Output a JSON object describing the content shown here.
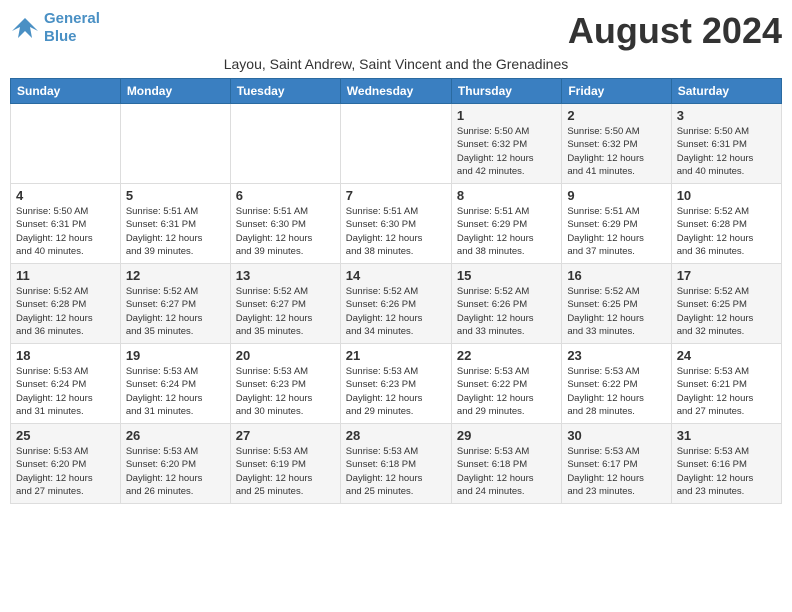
{
  "logo": {
    "line1": "General",
    "line2": "Blue"
  },
  "title": "August 2024",
  "location": "Layou, Saint Andrew, Saint Vincent and the Grenadines",
  "days_of_week": [
    "Sunday",
    "Monday",
    "Tuesday",
    "Wednesday",
    "Thursday",
    "Friday",
    "Saturday"
  ],
  "weeks": [
    [
      {
        "day": "",
        "info": ""
      },
      {
        "day": "",
        "info": ""
      },
      {
        "day": "",
        "info": ""
      },
      {
        "day": "",
        "info": ""
      },
      {
        "day": "1",
        "info": "Sunrise: 5:50 AM\nSunset: 6:32 PM\nDaylight: 12 hours\nand 42 minutes."
      },
      {
        "day": "2",
        "info": "Sunrise: 5:50 AM\nSunset: 6:32 PM\nDaylight: 12 hours\nand 41 minutes."
      },
      {
        "day": "3",
        "info": "Sunrise: 5:50 AM\nSunset: 6:31 PM\nDaylight: 12 hours\nand 40 minutes."
      }
    ],
    [
      {
        "day": "4",
        "info": "Sunrise: 5:50 AM\nSunset: 6:31 PM\nDaylight: 12 hours\nand 40 minutes."
      },
      {
        "day": "5",
        "info": "Sunrise: 5:51 AM\nSunset: 6:31 PM\nDaylight: 12 hours\nand 39 minutes."
      },
      {
        "day": "6",
        "info": "Sunrise: 5:51 AM\nSunset: 6:30 PM\nDaylight: 12 hours\nand 39 minutes."
      },
      {
        "day": "7",
        "info": "Sunrise: 5:51 AM\nSunset: 6:30 PM\nDaylight: 12 hours\nand 38 minutes."
      },
      {
        "day": "8",
        "info": "Sunrise: 5:51 AM\nSunset: 6:29 PM\nDaylight: 12 hours\nand 38 minutes."
      },
      {
        "day": "9",
        "info": "Sunrise: 5:51 AM\nSunset: 6:29 PM\nDaylight: 12 hours\nand 37 minutes."
      },
      {
        "day": "10",
        "info": "Sunrise: 5:52 AM\nSunset: 6:28 PM\nDaylight: 12 hours\nand 36 minutes."
      }
    ],
    [
      {
        "day": "11",
        "info": "Sunrise: 5:52 AM\nSunset: 6:28 PM\nDaylight: 12 hours\nand 36 minutes."
      },
      {
        "day": "12",
        "info": "Sunrise: 5:52 AM\nSunset: 6:27 PM\nDaylight: 12 hours\nand 35 minutes."
      },
      {
        "day": "13",
        "info": "Sunrise: 5:52 AM\nSunset: 6:27 PM\nDaylight: 12 hours\nand 35 minutes."
      },
      {
        "day": "14",
        "info": "Sunrise: 5:52 AM\nSunset: 6:26 PM\nDaylight: 12 hours\nand 34 minutes."
      },
      {
        "day": "15",
        "info": "Sunrise: 5:52 AM\nSunset: 6:26 PM\nDaylight: 12 hours\nand 33 minutes."
      },
      {
        "day": "16",
        "info": "Sunrise: 5:52 AM\nSunset: 6:25 PM\nDaylight: 12 hours\nand 33 minutes."
      },
      {
        "day": "17",
        "info": "Sunrise: 5:52 AM\nSunset: 6:25 PM\nDaylight: 12 hours\nand 32 minutes."
      }
    ],
    [
      {
        "day": "18",
        "info": "Sunrise: 5:53 AM\nSunset: 6:24 PM\nDaylight: 12 hours\nand 31 minutes."
      },
      {
        "day": "19",
        "info": "Sunrise: 5:53 AM\nSunset: 6:24 PM\nDaylight: 12 hours\nand 31 minutes."
      },
      {
        "day": "20",
        "info": "Sunrise: 5:53 AM\nSunset: 6:23 PM\nDaylight: 12 hours\nand 30 minutes."
      },
      {
        "day": "21",
        "info": "Sunrise: 5:53 AM\nSunset: 6:23 PM\nDaylight: 12 hours\nand 29 minutes."
      },
      {
        "day": "22",
        "info": "Sunrise: 5:53 AM\nSunset: 6:22 PM\nDaylight: 12 hours\nand 29 minutes."
      },
      {
        "day": "23",
        "info": "Sunrise: 5:53 AM\nSunset: 6:22 PM\nDaylight: 12 hours\nand 28 minutes."
      },
      {
        "day": "24",
        "info": "Sunrise: 5:53 AM\nSunset: 6:21 PM\nDaylight: 12 hours\nand 27 minutes."
      }
    ],
    [
      {
        "day": "25",
        "info": "Sunrise: 5:53 AM\nSunset: 6:20 PM\nDaylight: 12 hours\nand 27 minutes."
      },
      {
        "day": "26",
        "info": "Sunrise: 5:53 AM\nSunset: 6:20 PM\nDaylight: 12 hours\nand 26 minutes."
      },
      {
        "day": "27",
        "info": "Sunrise: 5:53 AM\nSunset: 6:19 PM\nDaylight: 12 hours\nand 25 minutes."
      },
      {
        "day": "28",
        "info": "Sunrise: 5:53 AM\nSunset: 6:18 PM\nDaylight: 12 hours\nand 25 minutes."
      },
      {
        "day": "29",
        "info": "Sunrise: 5:53 AM\nSunset: 6:18 PM\nDaylight: 12 hours\nand 24 minutes."
      },
      {
        "day": "30",
        "info": "Sunrise: 5:53 AM\nSunset: 6:17 PM\nDaylight: 12 hours\nand 23 minutes."
      },
      {
        "day": "31",
        "info": "Sunrise: 5:53 AM\nSunset: 6:16 PM\nDaylight: 12 hours\nand 23 minutes."
      }
    ]
  ]
}
